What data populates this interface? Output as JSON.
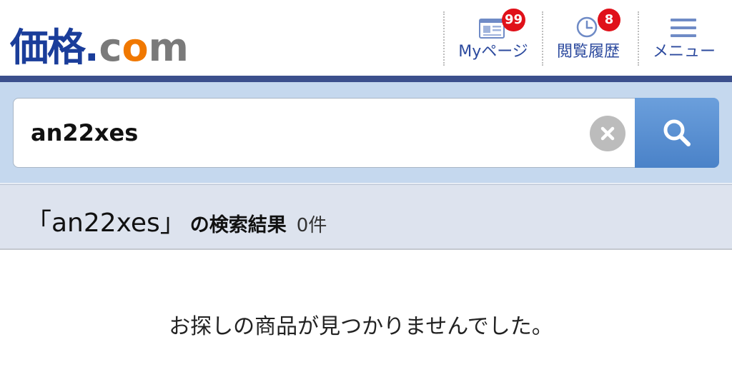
{
  "header": {
    "logo": {
      "kanji": "価格",
      "dot": ".",
      "c": "c",
      "o": "o",
      "m": "m"
    },
    "nav": {
      "mypage": {
        "label": "Myページ",
        "badge": "99",
        "icon": "mypage-card-icon"
      },
      "history": {
        "label": "閲覧履歴",
        "badge": "8",
        "icon": "clock-icon"
      },
      "menu": {
        "label": "メニュー",
        "icon": "hamburger-menu-icon"
      }
    }
  },
  "search": {
    "value": "an22xes",
    "clear_icon": "clear-x-icon",
    "submit_icon": "magnifier-icon"
  },
  "results": {
    "query_display": "「an22xes」",
    "suffix": "の検索結果",
    "count": "0件",
    "empty_message": "お探しの商品が見つかりませんでした。"
  },
  "colors": {
    "brand_blue": "#1a3d9a",
    "logo_orange": "#f07800",
    "badge_red": "#e0111a",
    "search_band": "#c5d8ee",
    "search_button": "#4a82c8",
    "result_bar": "#dde3ee"
  }
}
